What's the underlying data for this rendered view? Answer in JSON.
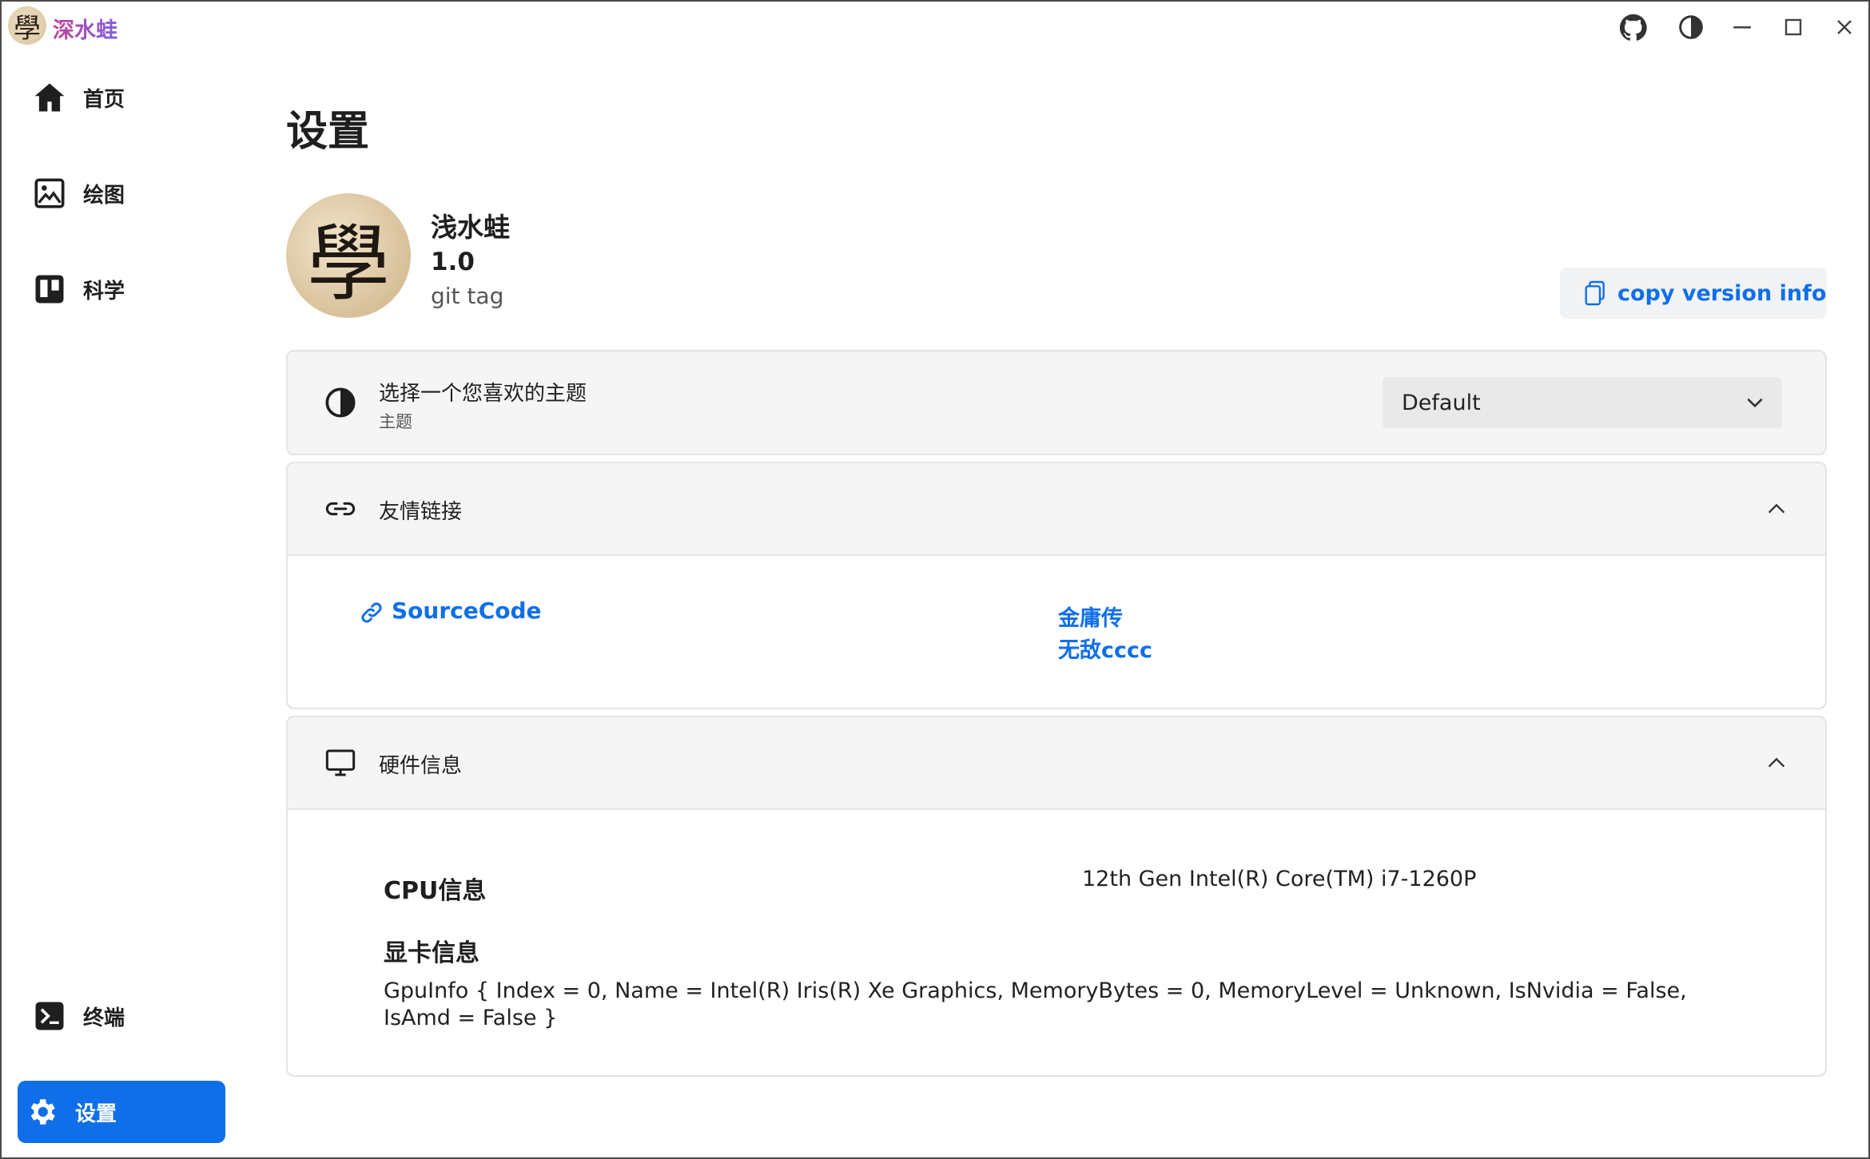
{
  "titlebar": {
    "app_title": "深水蛙",
    "logo_glyph": "學",
    "buttons": [
      "github-icon",
      "theme-toggle-icon",
      "minimize-icon",
      "maximize-icon",
      "close-icon"
    ]
  },
  "sidebar": {
    "items": [
      {
        "label": "首页",
        "icon": "home-icon"
      },
      {
        "label": "绘图",
        "icon": "image-icon"
      },
      {
        "label": "科学",
        "icon": "board-icon"
      }
    ],
    "bottom_items": [
      {
        "label": "终端",
        "icon": "terminal-icon"
      },
      {
        "label": "设置",
        "icon": "gear-icon",
        "active": true
      }
    ]
  },
  "main": {
    "title": "设置",
    "profile": {
      "avatar_glyph": "學",
      "name": "浅水蛙",
      "version": "1.0",
      "tag": "git tag",
      "copy_button": "copy version info"
    },
    "theme_card": {
      "title": "选择一个您喜欢的主题",
      "subtitle": "主题",
      "selected": "Default"
    },
    "links_card": {
      "title": "友情链接",
      "links": [
        "SourceCode",
        "金庸传",
        "无敌cccc"
      ]
    },
    "hardware_card": {
      "title": "硬件信息",
      "cpu_label": "CPU信息",
      "cpu_value": "12th Gen Intel(R) Core(TM) i7-1260P",
      "gpu_label": "显卡信息",
      "gpu_value": "GpuInfo { Index = 0, Name = Intel(R) Iris(R) Xe Graphics, MemoryBytes = 0, MemoryLevel = Unknown, IsNvidia = False, IsAmd = False }"
    }
  },
  "colors": {
    "accent": "#0f6fe8",
    "card_bg": "#f5f5f5",
    "border": "#e4e4e4"
  }
}
